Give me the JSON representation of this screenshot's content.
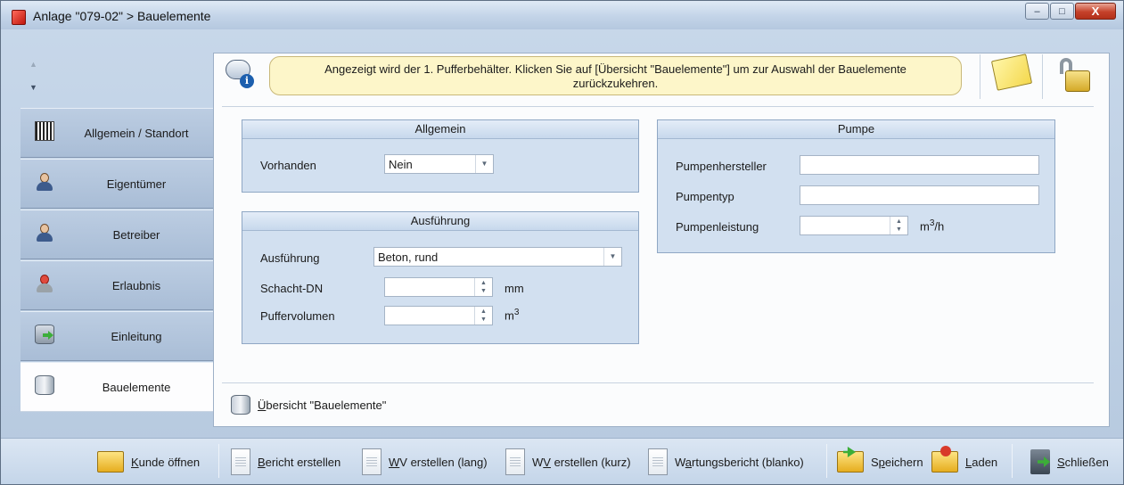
{
  "window": {
    "title": "Anlage \"079-02\" > Bauelemente",
    "minimize": "–",
    "maximize": "□",
    "close": "X"
  },
  "nav": {
    "items": [
      {
        "label": "Allgemein / Standort",
        "icon": "barcode-icon",
        "active": false
      },
      {
        "label": "Eigentümer",
        "icon": "person-icon",
        "active": false
      },
      {
        "label": "Betreiber",
        "icon": "person-icon",
        "active": false
      },
      {
        "label": "Erlaubnis",
        "icon": "permit-person-icon",
        "active": false
      },
      {
        "label": "Einleitung",
        "icon": "database-arrow-icon",
        "active": false
      },
      {
        "label": "Bauelemente",
        "icon": "database-icon",
        "active": true
      }
    ]
  },
  "notice": {
    "line1": "Angezeigt wird der 1. Pufferbehälter. Klicken Sie auf [Übersicht \"Bauelemente\"] um zur Auswahl der Bauelemente",
    "line2": "zurückzukehren."
  },
  "groups": {
    "allgemein": {
      "title": "Allgemein",
      "vorhanden_label": "Vorhanden",
      "vorhanden_value": "Nein"
    },
    "ausfuehrung": {
      "title": "Ausführung",
      "ausfuehrung_label": "Ausführung",
      "ausfuehrung_value": "Beton, rund",
      "schacht_label": "Schacht-DN",
      "schacht_value": "",
      "schacht_unit": "mm",
      "puffer_label": "Puffervolumen",
      "puffer_value": "",
      "puffer_unit_base": "m",
      "puffer_unit_sup": "3"
    },
    "pumpe": {
      "title": "Pumpe",
      "hersteller_label": "Pumpenhersteller",
      "hersteller_value": "",
      "typ_label": "Pumpentyp",
      "typ_value": "",
      "leistung_label": "Pumpenleistung",
      "leistung_value": "",
      "leistung_unit_base": "m",
      "leistung_unit_sup": "3",
      "leistung_unit_tail": "/h"
    }
  },
  "overview_link": {
    "mnemonic": "Ü",
    "rest": "bersicht \"Bauelemente\""
  },
  "toolbar": {
    "kunde": {
      "m": "K",
      "rest": "unde öffnen"
    },
    "bericht": {
      "m": "B",
      "rest": "ericht erstellen"
    },
    "wv_lang": {
      "m": "W",
      "rest": "V erstellen (lang)"
    },
    "wv_kurz_pre": "W",
    "wv_kurz_m": "V",
    "wv_kurz_rest": " erstellen (kurz)",
    "wartung_pre": "W",
    "wartung_m": "a",
    "wartung_rest": "rtungsbericht (blanko)",
    "speichern_pre": "S",
    "speichern_m": "p",
    "speichern_rest": "eichern",
    "laden": {
      "m": "L",
      "rest": "aden"
    },
    "schliessen": {
      "m": "S",
      "rest": "chließen"
    }
  },
  "colors": {
    "notice_bg": "#fdf6c9",
    "group_bg": "#d2e0f0",
    "nav_bg": "#a9bdd6",
    "close_button": "#c5412a"
  }
}
